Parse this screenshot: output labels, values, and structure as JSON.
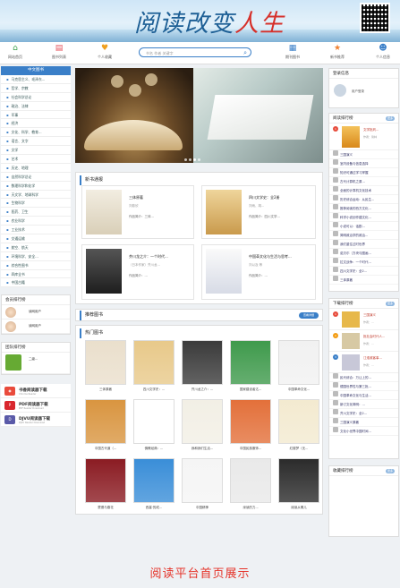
{
  "banner": {
    "title_main": "阅读改变",
    "title_accent": "人生"
  },
  "nav": {
    "items": [
      {
        "label": "网站首页",
        "icon": "home-icon",
        "color": "#3aa04a"
      },
      {
        "label": "图书列表",
        "icon": "book-list-icon",
        "color": "#e5505a"
      },
      {
        "label": "个人收藏",
        "icon": "favorite-icon",
        "color": "#f0a020"
      },
      {
        "label": "期刊图书",
        "icon": "journal-icon",
        "color": "#3a7fc8"
      },
      {
        "label": "新书推荐",
        "icon": "star-icon",
        "color": "#f08030"
      },
      {
        "label": "个人信息",
        "icon": "user-icon",
        "color": "#3a7fc8"
      }
    ],
    "search_placeholder": "书名 作者 关键字"
  },
  "sidebar": {
    "category_title": "中文图书",
    "categories": [
      "马克思主义、毛泽东...",
      "哲学、宗教",
      "社会科学总论",
      "政治、法律",
      "军事",
      "经济",
      "文化、科学、教育...",
      "语言、文字",
      "文学",
      "艺术",
      "历史、地理",
      "自然科学总论",
      "数理科学和化学",
      "天文学、地球科学",
      "生物科学",
      "医药、卫生",
      "农业科学",
      "工业技术",
      "交通运输",
      "航空、航天",
      "环境科学、安全...",
      "综合性图书",
      "四库全书",
      "中国古籍"
    ],
    "member_rank_title": "会员排行榜",
    "member_rank": [
      {
        "name": "读网用户"
      },
      {
        "name": "读网用户"
      }
    ],
    "team_rank_title": "团队排行榜",
    "team_rank": [
      {
        "name": "二级..."
      }
    ],
    "downloads": [
      {
        "label": "书香阅读器下载",
        "sub": "Chrome Reader",
        "color": "#e94b3c"
      },
      {
        "label": "PDF阅读器下载",
        "sub": "PDF Reader Download",
        "color": "#d9272e"
      },
      {
        "label": "DJVU阅读器下载",
        "sub": "DJVU Reader Download",
        "color": "#5a5aa8"
      }
    ]
  },
  "new_books": {
    "title": "新书通报",
    "items": [
      {
        "title": "三体原著",
        "author": "刘慈欣",
        "publisher": "作品简介：三体..."
      },
      {
        "title": "四川文学史：全2册",
        "author": "刘雨、胡...",
        "publisher": "作品简介：四川文学..."
      },
      {
        "title": "芥川龙之介：一个时代...",
        "author": "（日本作家）芥川龙...",
        "publisher": "作品简介：..."
      },
      {
        "title": "中国革文化与生活与思考...",
        "author": "刘以及 等",
        "publisher": "作品简介：..."
      }
    ]
  },
  "recommended": {
    "title": "推荐图书",
    "more": "查看详细"
  },
  "hot_books": {
    "title": "热门图书",
    "items": [
      {
        "label": "三体原著",
        "color": "#eadfcc"
      },
      {
        "label": "四川文学史：...",
        "color": "#e8c98a"
      },
      {
        "label": "芥川龙之介：...",
        "color": "#3b3b3b"
      },
      {
        "label": "国家建设者达...",
        "color": "#3f9a4c"
      },
      {
        "label": "中国革命文化...",
        "color": "#f1f1f1"
      },
      {
        "label": "中国古代道（...",
        "color": "#d99540"
      },
      {
        "label": "佛教经典：...",
        "color": "#888"
      },
      {
        "label": "我和我们生活...",
        "color": "#f2efe5"
      },
      {
        "label": "中国民族服饰...",
        "color": "#e3703a"
      },
      {
        "label": "红楼梦（无...",
        "color": "#f3ead0"
      },
      {
        "label": "蒙德与春花",
        "color": "#8b1c23"
      },
      {
        "label": "西塞·的成...",
        "color": "#3a8ed8"
      },
      {
        "label": "中国精神",
        "color": "#f5f5f5"
      },
      {
        "label": "深读的力...",
        "color": "#e9e9e9"
      },
      {
        "label": "阅读从哪儿",
        "color": "#2b2b2b"
      }
    ]
  },
  "right": {
    "login_title": "登录信息",
    "login_user": "用户登录",
    "reading_rank_title": "阅读排行榜",
    "reading_rank_feature": {
      "title": "文学批判...",
      "author": "作者：简林"
    },
    "reading_rank": [
      "三国演义",
      "室内设备与信息选择",
      "知识可通过学习掌握",
      "古代计算机之原...",
      "全面的计算机文化技术",
      "历史综合运动：从民生...",
      "推荐阅读的西方文化...",
      "科学小说创作建文化...",
      "小说可以：话剧...",
      "简明政治学的政治...",
      "我们重住过时世界",
      "诺贝尔（方块与图画...",
      "拉文战争：一个时代...",
      "四川文学史：全2...",
      "三体原著"
    ],
    "download_rank_title": "下载排行榜",
    "download_rank_feature": [
      {
        "title": "三国演义",
        "author": "作者：..."
      },
      {
        "title": "批社会时代人...",
        "author": "作者：..."
      },
      {
        "title": "江淮政客事...",
        "author": "作者：..."
      }
    ],
    "download_rank": [
      "民代综合：万让上的...",
      "德国世界性与第三批...",
      "中国革命文化与生活...",
      "新订文化简明：...",
      "芥川文学史：全2...",
      "三国演义原著",
      "文化小世界中国时间..."
    ],
    "favorites_title": "收藏排行榜"
  },
  "caption": "阅读平台首页展示"
}
